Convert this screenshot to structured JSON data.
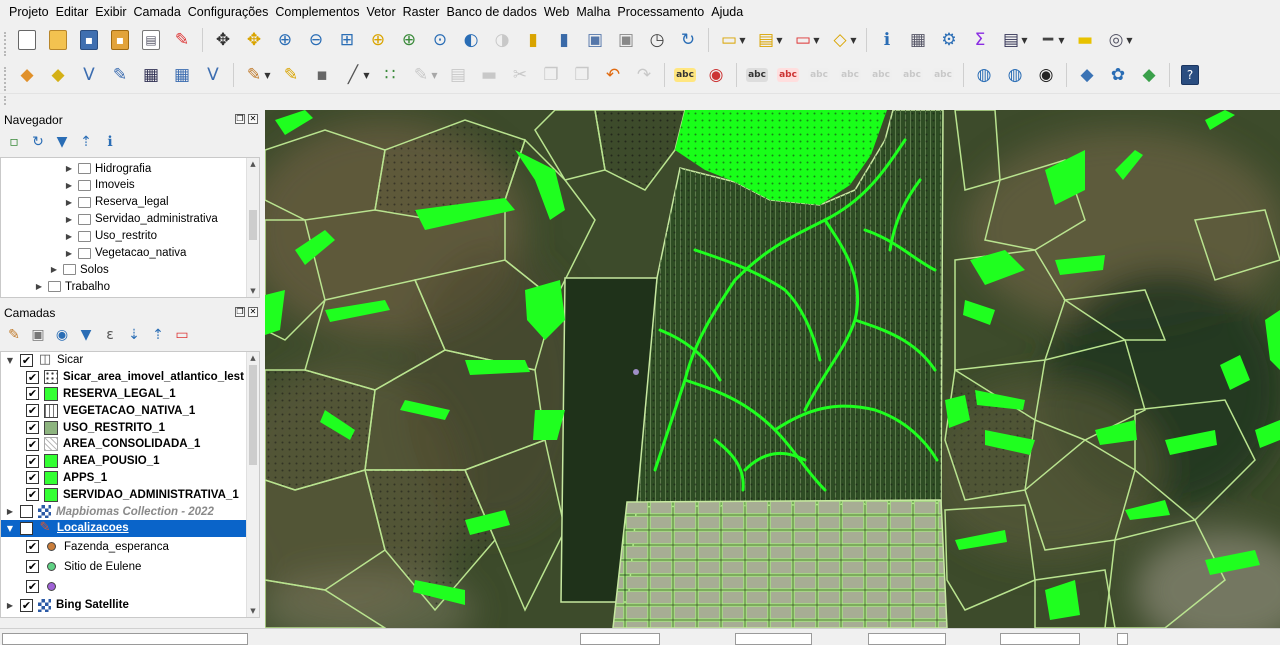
{
  "menu": {
    "items": [
      "Projeto",
      "Editar",
      "Exibir",
      "Camada",
      "Configurações",
      "Complementos",
      "Vetor",
      "Raster",
      "Banco de dados",
      "Web",
      "Malha",
      "Processamento",
      "Ajuda"
    ]
  },
  "toolbar1": {
    "groups": [
      [
        {
          "icon": "new-project-icon"
        },
        {
          "icon": "open-project-icon"
        },
        {
          "icon": "save-project-icon"
        },
        {
          "icon": "save-as-icon"
        },
        {
          "icon": "print-layout-icon"
        },
        {
          "icon": "style-manager-icon"
        }
      ],
      [
        {
          "icon": "pan-icon"
        },
        {
          "icon": "pan-selection-icon"
        },
        {
          "icon": "zoom-in-icon"
        },
        {
          "icon": "zoom-out-icon"
        },
        {
          "icon": "zoom-full-icon"
        },
        {
          "icon": "zoom-selection-icon"
        },
        {
          "icon": "zoom-layer-icon"
        },
        {
          "icon": "zoom-native-icon"
        },
        {
          "icon": "zoom-last-icon"
        },
        {
          "icon": "zoom-next-icon",
          "disabled": true
        },
        {
          "icon": "new-bookmark-icon"
        },
        {
          "icon": "show-bookmarks-icon"
        },
        {
          "icon": "new-map-view-icon"
        },
        {
          "icon": "new-3d-view-icon"
        },
        {
          "icon": "temporal-controller-icon"
        },
        {
          "icon": "refresh-icon"
        }
      ],
      [
        {
          "icon": "select-features-icon",
          "dropdown": true
        },
        {
          "icon": "select-value-icon",
          "dropdown": true
        },
        {
          "icon": "deselect-icon",
          "dropdown": true
        },
        {
          "icon": "select-location-icon",
          "dropdown": true
        }
      ],
      [
        {
          "icon": "identify-icon"
        },
        {
          "icon": "attribute-table-icon"
        },
        {
          "icon": "toolbox-icon"
        },
        {
          "icon": "statistics-icon"
        },
        {
          "icon": "open-table-icon",
          "dropdown": true
        },
        {
          "icon": "measure-icon",
          "dropdown": true
        },
        {
          "icon": "annotation-icon"
        },
        {
          "icon": "locate-icon",
          "dropdown": true
        }
      ]
    ]
  },
  "toolbar2": {
    "groups": [
      [
        {
          "icon": "data-source-manager-icon"
        },
        {
          "icon": "new-geopackage-icon"
        },
        {
          "icon": "new-shapefile-icon"
        },
        {
          "icon": "new-spatialite-icon"
        },
        {
          "icon": "new-virtual-layer-icon"
        },
        {
          "icon": "new-temporary-layer-icon"
        },
        {
          "icon": "new-vector-layer-icon"
        }
      ],
      [
        {
          "icon": "toggle-editing-icon",
          "dropdown": true
        },
        {
          "icon": "current-edits-icon"
        },
        {
          "icon": "save-edits-icon"
        },
        {
          "icon": "add-line-icon",
          "dropdown": true
        },
        {
          "icon": "vertex-tool-icon"
        },
        {
          "icon": "multi-edit-icon",
          "dropdown": true,
          "disabled": true
        },
        {
          "icon": "modify-attributes-icon",
          "disabled": true
        },
        {
          "icon": "delete-selected-icon",
          "disabled": true
        },
        {
          "icon": "cut-features-icon",
          "disabled": true
        },
        {
          "icon": "copy-features-icon",
          "disabled": true
        },
        {
          "icon": "paste-features-icon",
          "disabled": true
        },
        {
          "icon": "undo-icon"
        },
        {
          "icon": "redo-icon",
          "disabled": true
        }
      ],
      [
        {
          "icon": "layer-labeling-icon"
        },
        {
          "icon": "layer-diagram-icon"
        }
      ],
      [
        {
          "icon": "pin-labels-icon"
        },
        {
          "icon": "show-hide-labels-icon"
        },
        {
          "icon": "move-label-icon",
          "disabled": true
        },
        {
          "icon": "rotate-label-icon",
          "disabled": true
        },
        {
          "icon": "change-label-icon",
          "disabled": true
        },
        {
          "icon": "move-diagram-icon",
          "disabled": true
        },
        {
          "icon": "toggle-label-icon",
          "disabled": true
        }
      ],
      [
        {
          "icon": "globe-coord-icon"
        },
        {
          "icon": "globe-capture-icon"
        },
        {
          "icon": "gps-icon"
        }
      ],
      [
        {
          "icon": "python-console-icon"
        },
        {
          "icon": "plugin-icon"
        },
        {
          "icon": "plugin-2-icon"
        }
      ],
      [
        {
          "icon": "help-icon"
        }
      ]
    ]
  },
  "navegador": {
    "title": "Navegador",
    "tools": [
      "add-selected-icon",
      "refresh-icon",
      "filter-icon",
      "collapse-all-icon",
      "info-icon"
    ],
    "tree": [
      {
        "label": "Hidrografia",
        "depth": 3
      },
      {
        "label": "Imoveis",
        "depth": 3
      },
      {
        "label": "Reserva_legal",
        "depth": 3
      },
      {
        "label": "Servidao_administrativa",
        "depth": 3
      },
      {
        "label": "Uso_restrito",
        "depth": 3
      },
      {
        "label": "Vegetacao_nativa",
        "depth": 3
      },
      {
        "label": "Solos",
        "depth": 2
      },
      {
        "label": "Trabalho",
        "depth": 1
      }
    ]
  },
  "camadas": {
    "title": "Camadas",
    "tools": [
      "style-panel-icon",
      "add-group-icon",
      "map-themes-icon",
      "filter-legend-icon",
      "filter-expression-icon",
      "expand-all-icon",
      "collapse-all-icon",
      "remove-layer-icon"
    ],
    "layers": [
      {
        "label": "Sicar",
        "depth": 0,
        "expand": "open",
        "checked": true,
        "swatch": "group",
        "kind": "group"
      },
      {
        "label": "Sicar_area_imovel_atlantico_lest",
        "depth": 1,
        "checked": true,
        "swatch": "dots",
        "kind": "vector"
      },
      {
        "label": "RESERVA_LEGAL_1",
        "depth": 1,
        "checked": true,
        "swatch": "fill",
        "color": "#33ff33",
        "kind": "vector"
      },
      {
        "label": "VEGETACAO_NATIVA_1",
        "depth": 1,
        "checked": true,
        "swatch": "vlines",
        "kind": "vector"
      },
      {
        "label": "USO_RESTRITO_1",
        "depth": 1,
        "checked": true,
        "swatch": "fill",
        "color": "#8db47f",
        "kind": "vector"
      },
      {
        "label": "AREA_CONSOLIDADA_1",
        "depth": 1,
        "checked": true,
        "swatch": "hatch",
        "kind": "vector"
      },
      {
        "label": "AREA_POUSIO_1",
        "depth": 1,
        "checked": true,
        "swatch": "fill",
        "color": "#33ff33",
        "kind": "vector"
      },
      {
        "label": "APPS_1",
        "depth": 1,
        "checked": true,
        "swatch": "fill",
        "color": "#33ff33",
        "kind": "vector"
      },
      {
        "label": "SERVIDAO_ADMINISTRATIVA_1",
        "depth": 1,
        "checked": true,
        "swatch": "fill",
        "color": "#33ff33",
        "kind": "vector"
      },
      {
        "label": "Mapbiomas Collection - 2022",
        "depth": 0,
        "expand": "closed",
        "checked": false,
        "swatch": "raster",
        "kind": "raster"
      },
      {
        "label": "Localizacoes",
        "depth": 0,
        "expand": "open",
        "checked": true,
        "swatch": "categorized",
        "kind": "vector",
        "selected": true
      },
      {
        "label": "Fazenda_esperanca",
        "depth": 1,
        "checked": true,
        "swatch": "circle",
        "color": "#c97d3b",
        "kind": "category"
      },
      {
        "label": "Sitio de Eulene",
        "depth": 1,
        "checked": true,
        "swatch": "circle",
        "color": "#5fd184",
        "kind": "category"
      },
      {
        "label": "",
        "depth": 1,
        "checked": true,
        "swatch": "circle",
        "color": "#9f62d6",
        "kind": "category"
      },
      {
        "label": "Bing Satellite",
        "depth": 0,
        "expand": "closed",
        "checked": true,
        "swatch": "raster",
        "kind": "raster"
      }
    ]
  },
  "colors": {
    "reserva_legal_fill": "#19ff19",
    "parcel_outline": "#b9e38f",
    "selection_highlight": "#0a64c9"
  }
}
